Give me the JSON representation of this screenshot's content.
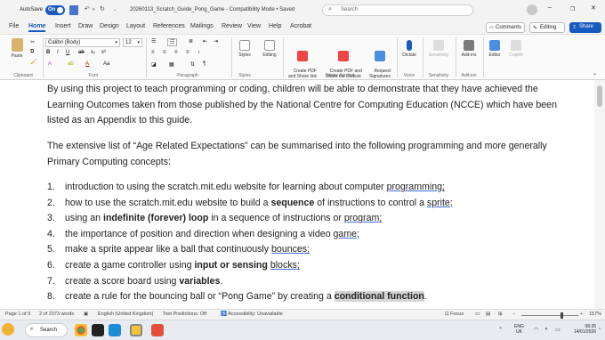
{
  "titlebar": {
    "autosave": "AutoSave",
    "autosave_state": "On",
    "filename": "20260113_Scratch_Guide_Pong_Game",
    "mode": " - Compatibility Mode • Saved",
    "search_placeholder": "Search"
  },
  "menu": {
    "tabs": [
      "File",
      "Home",
      "Insert",
      "Draw",
      "Design",
      "Layout",
      "References",
      "Mailings",
      "Review",
      "View",
      "Help",
      "Acrobat"
    ],
    "active": "Home",
    "comments": "Comments",
    "editing": "Editing",
    "share": "Share"
  },
  "ribbon": {
    "paste": "Paste",
    "font_name": "Calibri (Body)",
    "font_size": "12",
    "styles": "Styles",
    "editing": "Editing",
    "create_pdf": "Create PDF\nand Share link",
    "create_pdf_outlook": "Create PDF and\nShare via Outlook",
    "request_signatures": "Request\nSignatures",
    "dictate": "Dictate",
    "sensitivity": "Sensitivity",
    "addins": "Add-ins",
    "editor": "Editor",
    "copilot": "Copilot",
    "groups": {
      "clipboard": "Clipboard",
      "font": "Font",
      "paragraph": "Paragraph",
      "styles": "Styles",
      "adobe": "Adobe Acrobat",
      "voice": "Voice",
      "sensitivity": "Sensitivity",
      "addins": "Add-ins"
    }
  },
  "document": {
    "para1": "By using this project to teach programming or coding, children will be able to demonstrate that they have achieved the Learning Outcomes taken from those published by the National Centre for Computing Education (NCCE) which have been listed as an Appendix to this guide.",
    "para2": "The extensive list of “Age Related Expectations” can be summarised into the following programming and more generally Primary Computing concepts:",
    "list": [
      {
        "n": "1.",
        "parts": [
          {
            "t": "introduction to using the scratch.mit.edu website for learning about computer "
          },
          {
            "t": "programming;",
            "u": true
          }
        ]
      },
      {
        "n": "2.",
        "parts": [
          {
            "t": "how to use the scratch.mit.edu website to build a "
          },
          {
            "t": "sequence",
            "b": true
          },
          {
            "t": " of instructions to control a "
          },
          {
            "t": "sprite;",
            "u": true
          }
        ]
      },
      {
        "n": "3.",
        "parts": [
          {
            "t": "using an "
          },
          {
            "t": "indefinite (forever) loop",
            "b": true
          },
          {
            "t": " in a sequence of instructions or "
          },
          {
            "t": "program;",
            "u": true
          }
        ]
      },
      {
        "n": "4.",
        "parts": [
          {
            "t": "the importance of position and direction when designing a video "
          },
          {
            "t": "game;",
            "u": true
          }
        ]
      },
      {
        "n": "5.",
        "parts": [
          {
            "t": "make a sprite appear like a ball that continuously "
          },
          {
            "t": "bounces;",
            "u": true
          }
        ]
      },
      {
        "n": "6.",
        "parts": [
          {
            "t": "create a game controller using "
          },
          {
            "t": "input or sensing",
            "b": true
          },
          {
            "t": " "
          },
          {
            "t": "blocks;",
            "u": true
          }
        ]
      },
      {
        "n": "7.",
        "parts": [
          {
            "t": "create a score board using "
          },
          {
            "t": "variables",
            "b": true
          },
          {
            "t": "."
          }
        ]
      },
      {
        "n": "8.",
        "parts": [
          {
            "t": "create a rule for the bouncing ball or “Pong Game” by creating a "
          },
          {
            "t": "conditional function",
            "b": true,
            "h": true
          },
          {
            "t": "."
          }
        ]
      }
    ]
  },
  "status": {
    "page": "Page 1 of 9",
    "words": "2 of 2373 words",
    "language": "English (United Kingdom)",
    "predictions": "Text Predictions: Off",
    "accessibility": "Accessibility: Unavailable",
    "focus": "Focus",
    "zoom": "157%"
  },
  "taskbar": {
    "search": "Search",
    "lang1": "ENG",
    "lang2": "UK",
    "time": "08:35",
    "date": "14/01/2026"
  },
  "colors": {
    "accent": "#185abd",
    "autosave_on": "#185abd"
  }
}
